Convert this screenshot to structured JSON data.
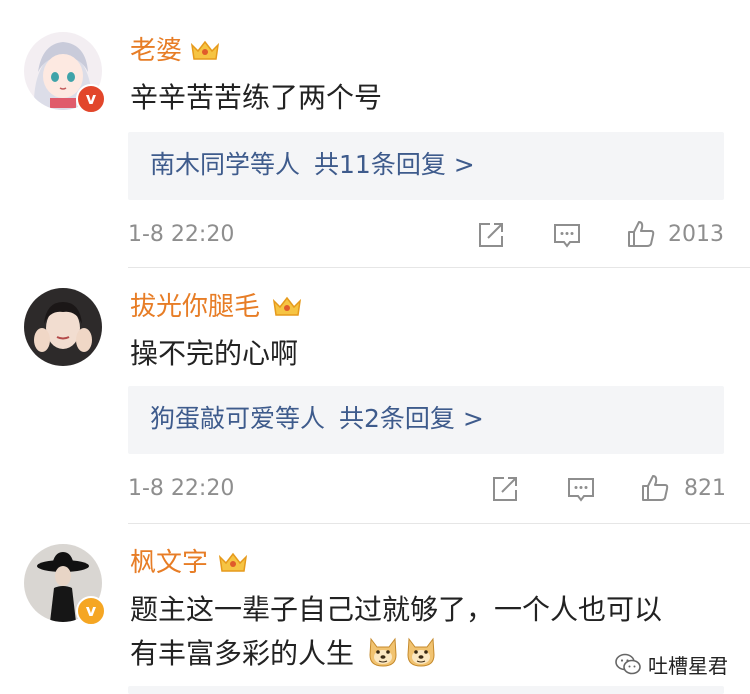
{
  "comments": [
    {
      "username": "老婆",
      "text": "辛辛苦苦练了两个号",
      "reply_users": "南木同学等人",
      "reply_count": "共11条回复 >",
      "time": "1-8 22:20",
      "likes": "2013",
      "verified": "v",
      "verified_color": "#e2462b"
    },
    {
      "username": "拔光你腿毛",
      "text": "操不完的心啊",
      "reply_users": "狗蛋敲可爱等人",
      "reply_count": "共2条回复 >",
      "time": "1-8 22:20",
      "likes": "821"
    },
    {
      "username": "枫文字",
      "text_line1": "题主这一辈子自己过就够了，一个人也可以",
      "text_line2": "有丰富多彩的人生",
      "verified": "v",
      "verified_color": "#f5a623",
      "emojis": [
        "doge-emoji",
        "doge-emoji"
      ]
    }
  ],
  "watermark": {
    "label": "吐槽星君",
    "icon": "wechat-icon"
  },
  "colors": {
    "username": "#e77d26",
    "reply_link": "#3e5b8c",
    "meta": "#8e8e8e",
    "reply_box_bg": "#f4f5f7"
  }
}
